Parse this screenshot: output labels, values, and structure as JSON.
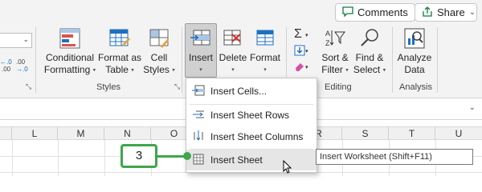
{
  "top_buttons": {
    "comments": "Comments",
    "share": "Share",
    "share_chevron": "⌄"
  },
  "number_group": {
    "dropdown_chevron": "⌄",
    "increase_decimal": "←.0\n.00",
    "decrease_decimal": ".00\n→.0",
    "launcher": "⤡"
  },
  "styles_group": {
    "conditional_formatting": {
      "line1": "Conditional",
      "line2": "Formatting"
    },
    "format_as_table": {
      "line1": "Format as",
      "line2": "Table"
    },
    "cell_styles": {
      "line1": "Cell",
      "line2": "Styles"
    },
    "label": "Styles",
    "launcher": "⤡"
  },
  "cells_group": {
    "insert": "Insert",
    "delete": "Delete",
    "format": "Format"
  },
  "editing_group": {
    "sum_icon": "Σ",
    "sort_filter": {
      "line1": "Sort &",
      "line2": "Filter"
    },
    "find_select": {
      "line1": "Find &",
      "line2": "Select"
    },
    "label": "Editing"
  },
  "analysis_group": {
    "analyze_data": {
      "line1": "Analyze",
      "line2": "Data"
    },
    "label": "Analysis"
  },
  "formula_bar": {
    "chevron": "⌄"
  },
  "columns": [
    "L",
    "M",
    "N",
    "O",
    "R",
    "S",
    "T",
    "U"
  ],
  "insert_menu": {
    "items": [
      {
        "label": "Insert Cells...",
        "icon": "insert-cells-icon"
      },
      {
        "label": "Insert Sheet Rows",
        "icon": "insert-rows-icon"
      },
      {
        "label": "Insert Sheet Columns",
        "icon": "insert-columns-icon"
      },
      {
        "label": "Insert Sheet",
        "icon": "insert-sheet-icon"
      }
    ]
  },
  "callout": {
    "number": "3"
  },
  "tooltip": {
    "text": "Insert Worksheet (Shift+F11)"
  },
  "colors": {
    "accent_green": "#3fa64b",
    "ribbon_bg": "#f3f3f3",
    "excel_green": "#107c41"
  }
}
